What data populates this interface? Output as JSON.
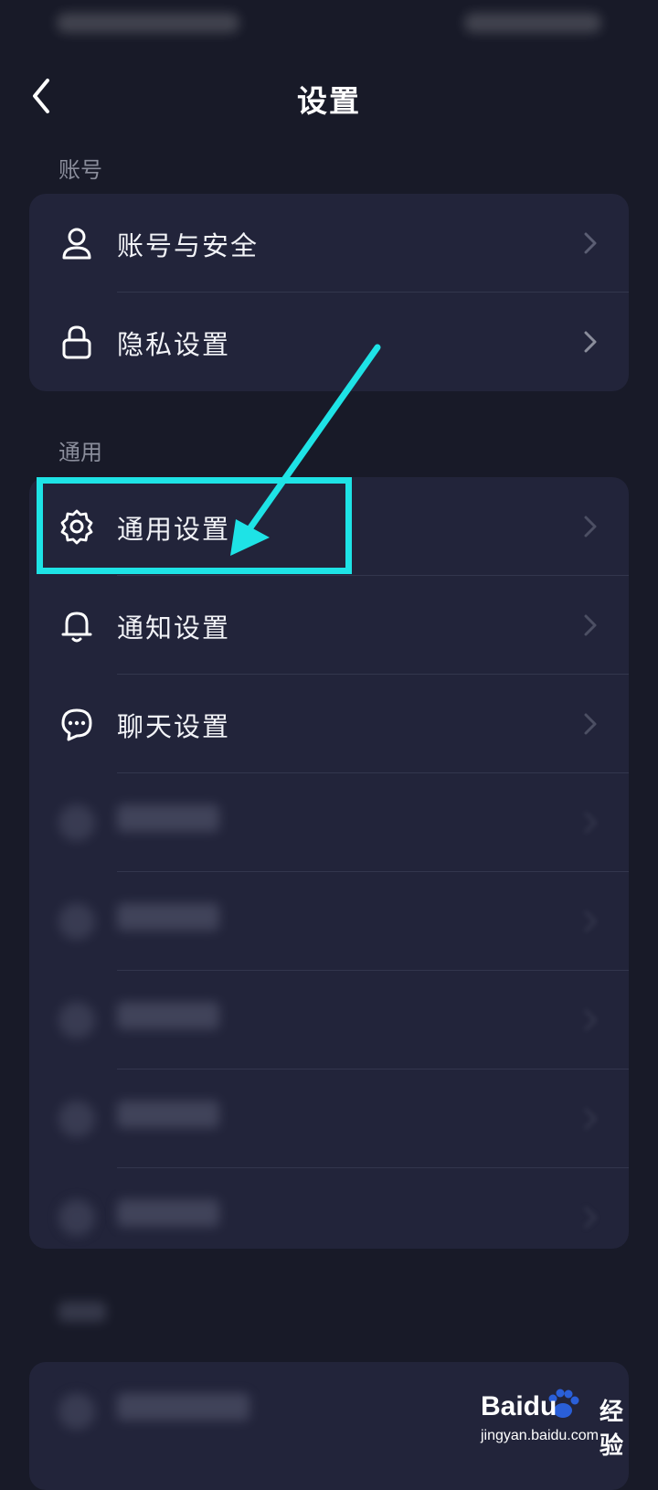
{
  "header": {
    "title": "设置"
  },
  "sections": [
    {
      "label": "账号",
      "items": [
        {
          "label": "账号与安全",
          "icon": "person-icon"
        },
        {
          "label": "隐私设置",
          "icon": "lock-icon"
        }
      ]
    },
    {
      "label": "通用",
      "items": [
        {
          "label": "通用设置",
          "icon": "gear-icon"
        },
        {
          "label": "通知设置",
          "icon": "bell-icon"
        },
        {
          "label": "聊天设置",
          "icon": "chat-bubble-icon"
        }
      ]
    }
  ],
  "annotation": {
    "highlight_color": "#1ee3e6"
  },
  "watermark": {
    "brand": "Baidu",
    "cn": "经验",
    "url": "jingyan.baidu.com"
  }
}
